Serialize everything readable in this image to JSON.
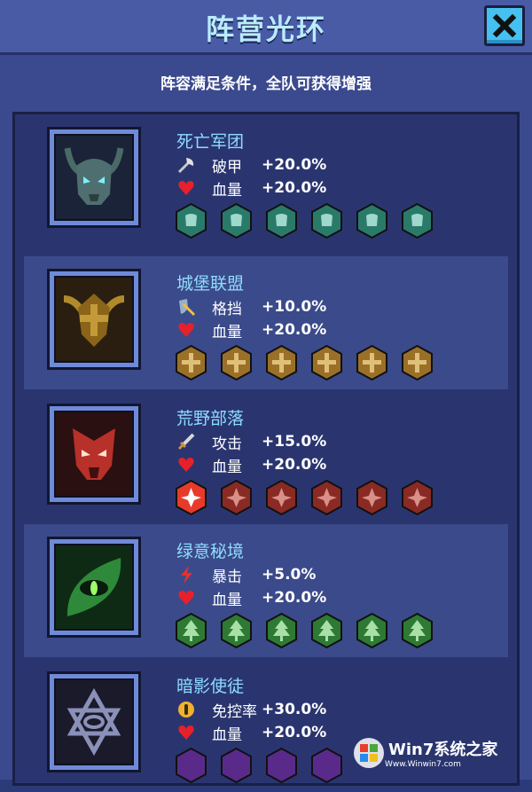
{
  "header": {
    "title": "阵营光环"
  },
  "subtitle": "阵容满足条件，全队可获得增强",
  "factions": [
    {
      "name": "死亡军团",
      "color": "#2d8a7a",
      "stats": [
        {
          "icon": "axe-icon",
          "label": "破甲",
          "value": "+20.0%"
        },
        {
          "icon": "heart-icon",
          "label": "血量",
          "value": "+20.0%"
        }
      ],
      "active_count": 0
    },
    {
      "name": "城堡联盟",
      "color": "#a07a30",
      "stats": [
        {
          "icon": "shield-sword-icon",
          "label": "格挡",
          "value": "+10.0%"
        },
        {
          "icon": "heart-icon",
          "label": "血量",
          "value": "+20.0%"
        }
      ],
      "active_count": 0
    },
    {
      "name": "荒野部落",
      "color": "#a8302a",
      "stats": [
        {
          "icon": "sword-icon",
          "label": "攻击",
          "value": "+15.0%"
        },
        {
          "icon": "heart-icon",
          "label": "血量",
          "value": "+20.0%"
        }
      ],
      "active_count": 1
    },
    {
      "name": "绿意秘境",
      "color": "#2e8a3a",
      "stats": [
        {
          "icon": "lightning-icon",
          "label": "暴击",
          "value": "+5.0%"
        },
        {
          "icon": "heart-icon",
          "label": "血量",
          "value": "+20.0%"
        }
      ],
      "active_count": 0
    },
    {
      "name": "暗影使徒",
      "color": "#6a3a9a",
      "stats": [
        {
          "icon": "control-icon",
          "label": "免控率",
          "value": "+30.0%"
        },
        {
          "icon": "heart-icon",
          "label": "血量",
          "value": "+20.0%"
        }
      ],
      "active_count": 0
    }
  ],
  "watermark": {
    "text": "Win7系统之家",
    "url": "Www.Winwin7.com"
  }
}
